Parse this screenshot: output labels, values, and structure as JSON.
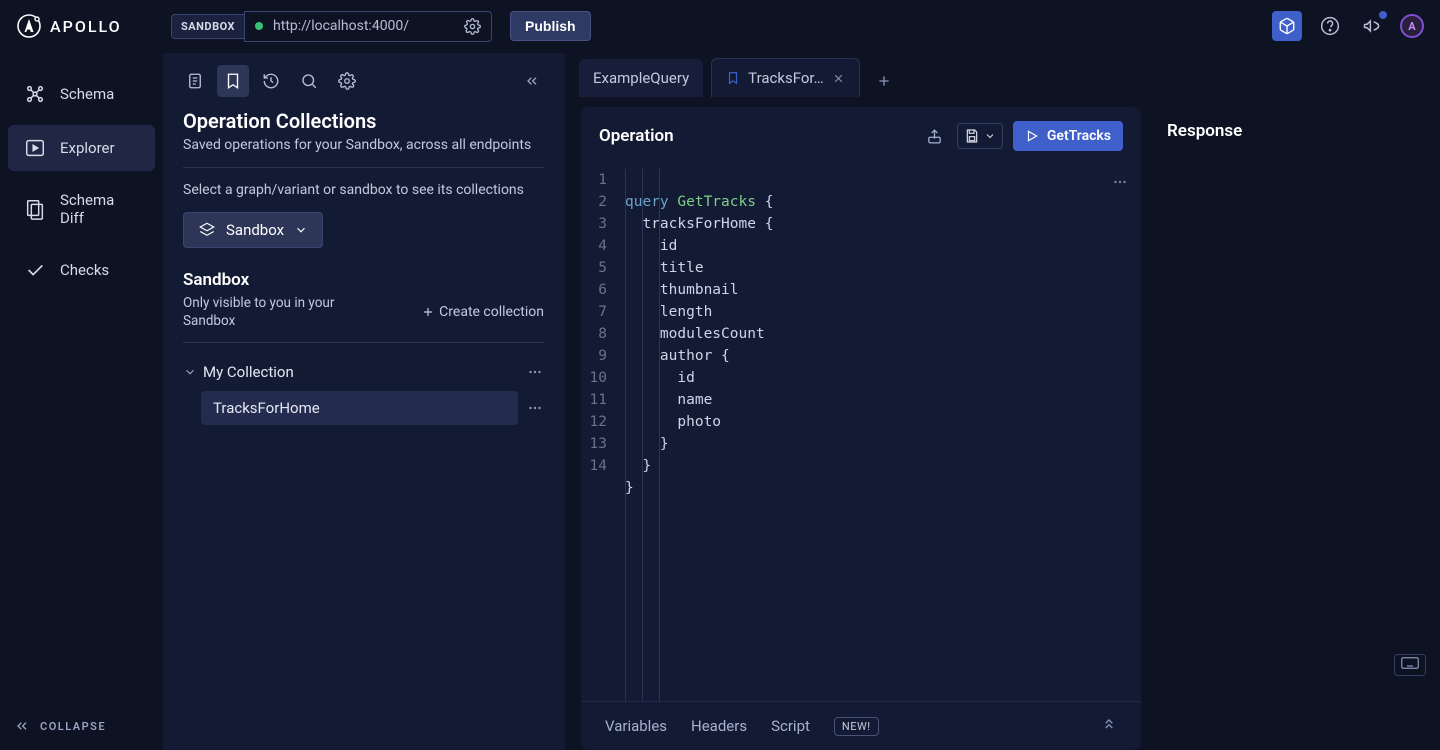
{
  "topbar": {
    "logo_text": "APOLLO",
    "sandbox_badge": "SANDBOX",
    "url": "http://localhost:4000/",
    "publish": "Publish",
    "avatar_initial": "A"
  },
  "leftnav": {
    "items": [
      {
        "label": "Schema"
      },
      {
        "label": "Explorer"
      },
      {
        "label": "Schema Diff"
      },
      {
        "label": "Checks"
      }
    ],
    "collapse": "COLLAPSE"
  },
  "collections_panel": {
    "title": "Operation Collections",
    "subtitle": "Saved operations for your Sandbox, across all endpoints",
    "hint": "Select a graph/variant or sandbox to see its collections",
    "scope_label": "Sandbox",
    "section_title": "Sandbox",
    "section_desc": "Only visible to you in your Sandbox",
    "create_label": "Create collection",
    "collection_name": "My Collection",
    "collection_item": "TracksForHome"
  },
  "tabs": {
    "items": [
      {
        "label": "ExampleQuery",
        "active": false,
        "bookmarked": false
      },
      {
        "label": "TracksFor…",
        "active": true,
        "bookmarked": true
      }
    ]
  },
  "operation": {
    "header_title": "Operation",
    "run_label": "GetTracks",
    "line_count": 14,
    "code": {
      "l1_kw": "query",
      "l1_nm": "GetTracks",
      "l2_fld": "tracksForHome",
      "l3": "id",
      "l4": "title",
      "l5": "thumbnail",
      "l6": "length",
      "l7": "modulesCount",
      "l8_fld": "author",
      "l9": "id",
      "l10": "name",
      "l11": "photo"
    },
    "footer": {
      "variables": "Variables",
      "headers": "Headers",
      "script": "Script",
      "new": "NEW!"
    }
  },
  "response": {
    "title": "Response"
  }
}
